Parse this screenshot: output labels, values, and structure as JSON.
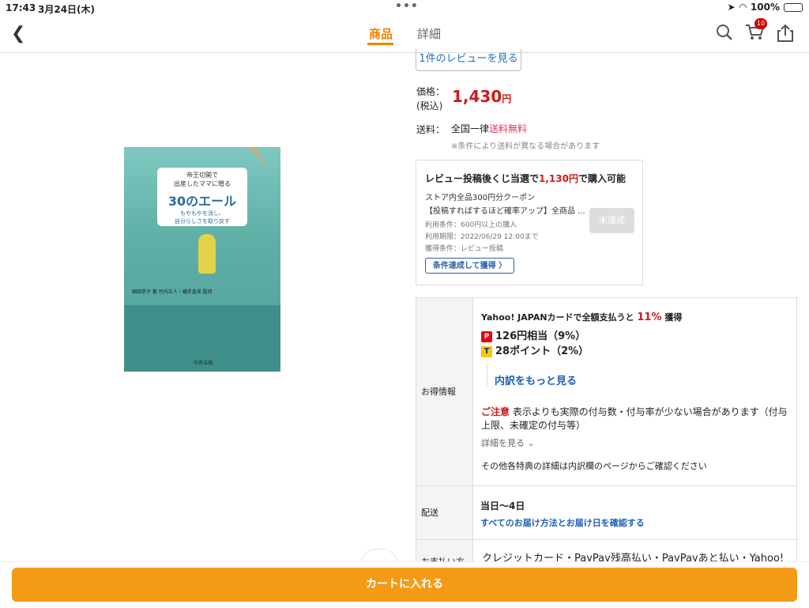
{
  "status_bar": {
    "time": "17:43",
    "date": "3月24日(木)",
    "battery": "100%"
  },
  "nav": {
    "tab_product": "商品",
    "tab_detail": "詳細",
    "cart_count": "10"
  },
  "cover": {
    "line1": "帝王切開で",
    "line2": "出産したママに贈る",
    "title": "30のエール",
    "sub1": "もやもやを消し、",
    "sub2": "自分らしさを取り戻す",
    "authors": "細田恭子 著 竹内正人・横手直美 監修",
    "publisher": "中央法規"
  },
  "review_link": "1件のレビューを見る",
  "price": {
    "label1": "価格：",
    "label2": "(税込)",
    "amount": "1,430",
    "unit": "円"
  },
  "shipping": {
    "label": "送料：",
    "text": "全国一律",
    "free": "送料無料",
    "note": "※条件により送料が異なる場合があります"
  },
  "coupon": {
    "title_pre": "レビュー投稿後くじ当選で",
    "title_amount": "1,130円",
    "title_post": "で購入可能",
    "line1": "ストア内全品300円分クーポン",
    "line2": "【投稿すればするほど確率アップ】全商品 ...",
    "cond1": "利用条件：600円以上の購入",
    "cond2": "利用期限：2022/06/29 12:00まで",
    "cond3": "獲得条件：レビュー投稿",
    "status": "未達成",
    "get_button": "条件達成して獲得 〉"
  },
  "benefits": {
    "label": "お得情報",
    "headline_pre": "Yahoo! JAPANカードで全額支払うと",
    "headline_pct": "11%",
    "headline_post": "獲得",
    "paypay": "126円相当（9%）",
    "tpoint": "28ポイント（2%）",
    "breakdown_link": "内訳をもっと見る",
    "caution_label": "ご注意",
    "caution_text": "表示よりも実際の付与数・付与率が少ない場合があります（付与上限、未確定の付与等）",
    "details": "詳細を見る ⌄",
    "other": "その他各特典の詳細は内訳欄のページからご確認ください"
  },
  "delivery": {
    "label": "配送",
    "days": "当日〜4日",
    "link": "すべてのお届け方法とお届け日を確認する"
  },
  "payment": {
    "label": "お支払い方法",
    "text": "クレジットカード・PayPay残高払い・PayPayあと払い・Yahoo!"
  },
  "cart_button": "カートに入れる"
}
